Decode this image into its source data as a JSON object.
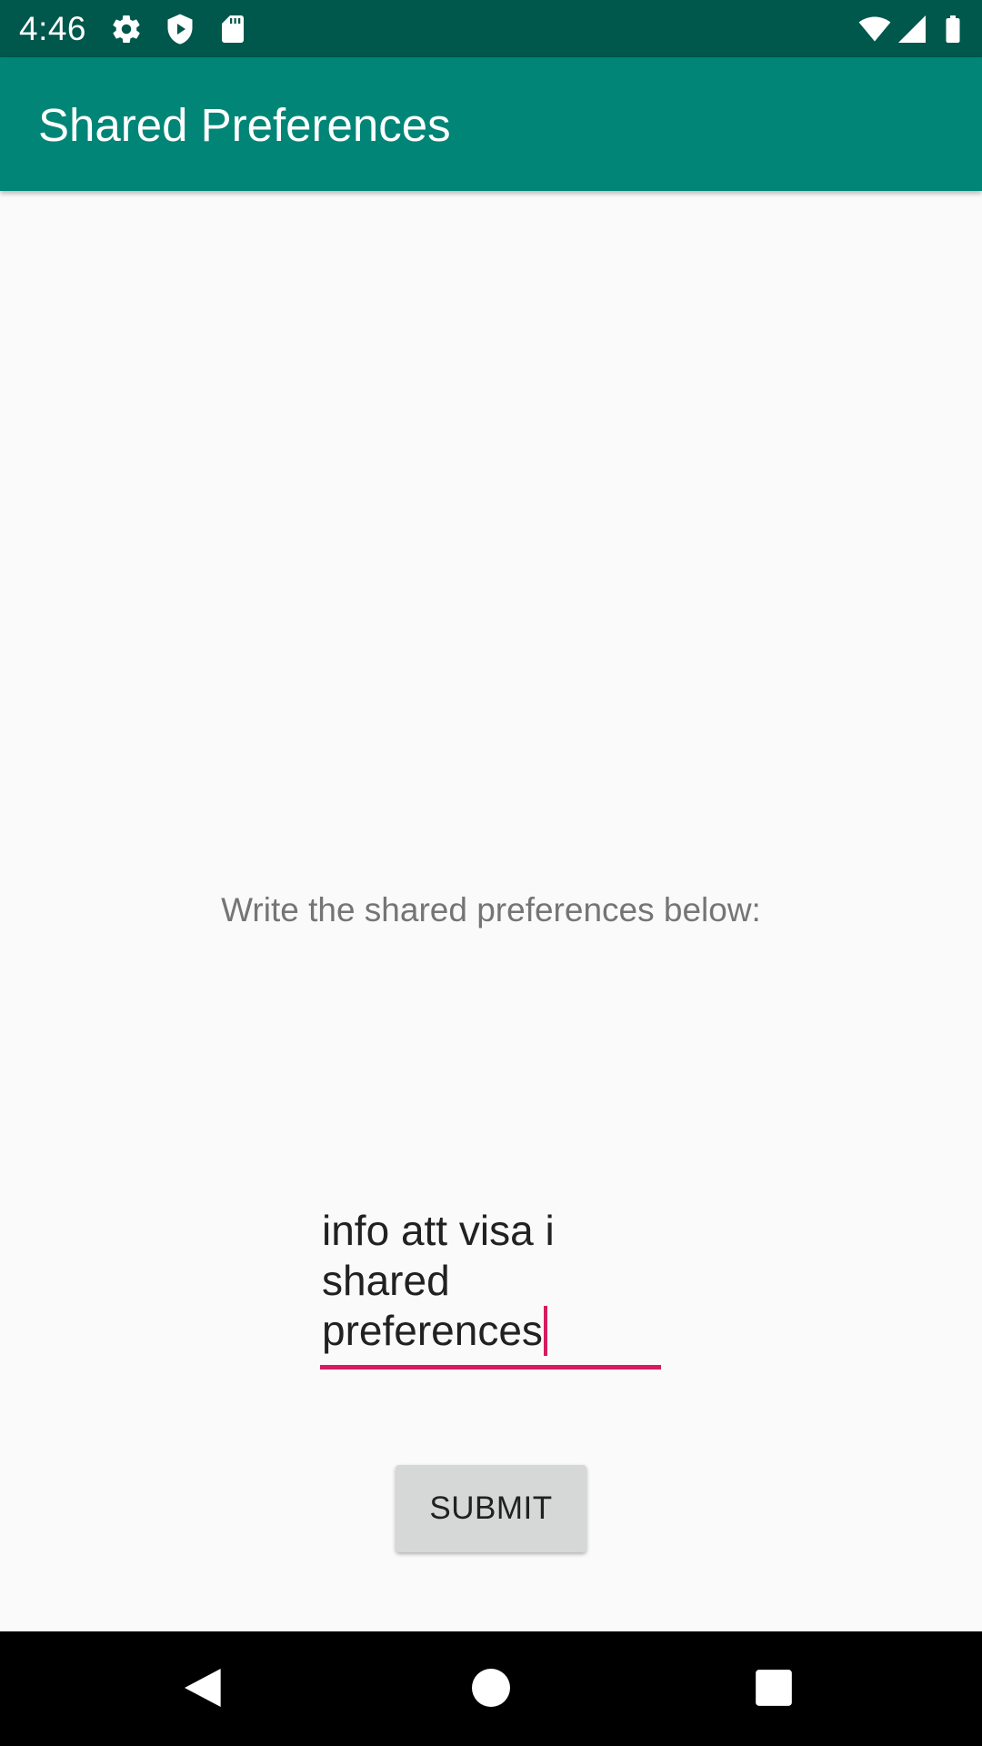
{
  "status_bar": {
    "time": "4:46",
    "icons": [
      "gear-icon",
      "shield-icon",
      "sd-card-icon",
      "wifi-icon",
      "signal-icon",
      "battery-icon"
    ]
  },
  "app_bar": {
    "title": "Shared Preferences",
    "color": "#008577"
  },
  "content": {
    "prompt": "Write the shared preferences below:",
    "input_value": "info att visa i\nshared\npreferences",
    "accent_color": "#d81b60",
    "submit_label": "SUBMIT"
  },
  "nav_bar": {
    "buttons": [
      "back-icon",
      "home-icon",
      "recents-icon"
    ]
  }
}
